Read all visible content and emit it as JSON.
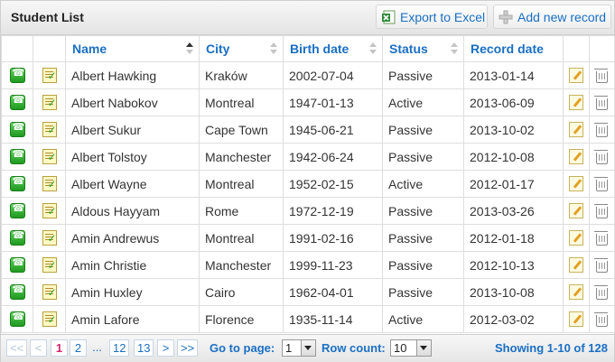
{
  "window": {
    "title": "Student List"
  },
  "toolbar": {
    "export_label": "Export to Excel",
    "add_label": "Add new record"
  },
  "columns": [
    "Name",
    "City",
    "Birth date",
    "Status",
    "Record date"
  ],
  "rows": [
    {
      "name": "Albert Hawking",
      "city": "Kraków",
      "birth": "2002-07-04",
      "status": "Passive",
      "record": "2013-01-14"
    },
    {
      "name": "Albert Nabokov",
      "city": "Montreal",
      "birth": "1947-01-13",
      "status": "Active",
      "record": "2013-06-09"
    },
    {
      "name": "Albert Sukur",
      "city": "Cape Town",
      "birth": "1945-06-21",
      "status": "Passive",
      "record": "2013-10-02"
    },
    {
      "name": "Albert Tolstoy",
      "city": "Manchester",
      "birth": "1942-06-24",
      "status": "Passive",
      "record": "2012-10-08"
    },
    {
      "name": "Albert Wayne",
      "city": "Montreal",
      "birth": "1952-02-15",
      "status": "Active",
      "record": "2012-01-17"
    },
    {
      "name": "Aldous Hayyam",
      "city": "Rome",
      "birth": "1972-12-19",
      "status": "Passive",
      "record": "2013-03-26"
    },
    {
      "name": "Amin Andrewus",
      "city": "Montreal",
      "birth": "1991-02-16",
      "status": "Passive",
      "record": "2012-01-18"
    },
    {
      "name": "Amin Christie",
      "city": "Manchester",
      "birth": "1999-11-23",
      "status": "Passive",
      "record": "2012-10-13"
    },
    {
      "name": "Amin Huxley",
      "city": "Cairo",
      "birth": "1962-04-01",
      "status": "Passive",
      "record": "2013-10-08"
    },
    {
      "name": "Amin Lafore",
      "city": "Florence",
      "birth": "1935-11-14",
      "status": "Active",
      "record": "2012-03-02"
    }
  ],
  "pagination": {
    "first": "<<",
    "prev": "<",
    "pages": [
      "1",
      "2"
    ],
    "ellipsis": "...",
    "pages_end": [
      "12",
      "13"
    ],
    "next": ">",
    "last": ">>",
    "current": "1",
    "goto_label": "Go to page:",
    "goto_value": "1",
    "rowcount_label": "Row count:",
    "rowcount_value": "10",
    "showing": "Showing 1-10 of 128"
  },
  "colors": {
    "accent": "#1a6fc4",
    "current_page": "#d6246b"
  },
  "icons": [
    "excel-icon",
    "add-icon",
    "phone-icon",
    "notes-icon",
    "edit-icon",
    "trash-icon"
  ]
}
